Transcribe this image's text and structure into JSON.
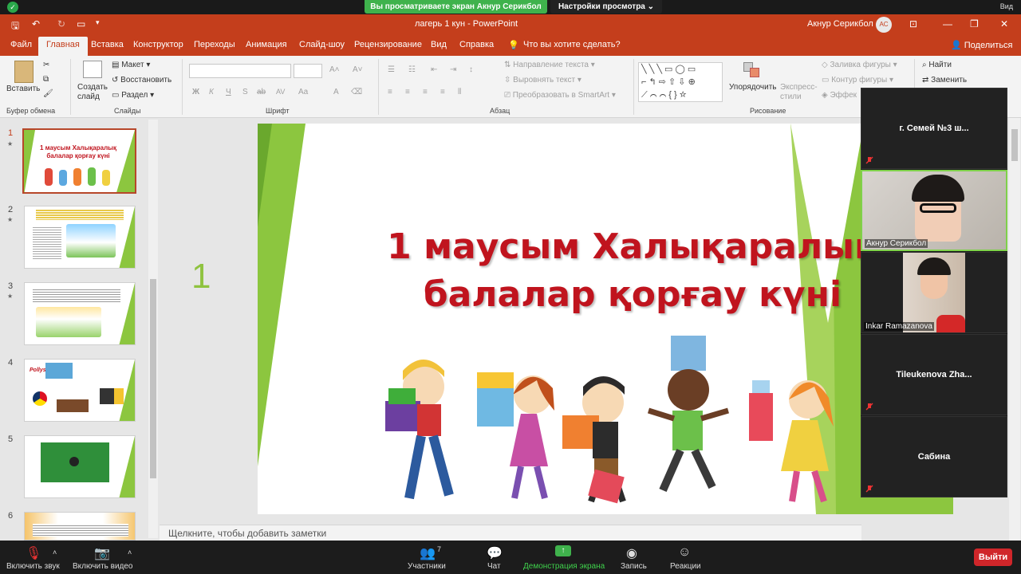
{
  "zoom": {
    "share_banner": "Вы просматриваете экран Акнур Серикбол",
    "view_settings": "Настройки просмотра ⌄",
    "view_label": "Вид",
    "toolbar": {
      "mute": "Включить звук",
      "video": "Включить видео",
      "participants": "Участники",
      "participants_count": "7",
      "chat": "Чат",
      "share": "Демонстрация экрана",
      "record": "Запись",
      "reactions": "Реакции",
      "leave": "Выйти"
    },
    "participants": [
      {
        "name": "г. Семей №3 ш...",
        "video": false
      },
      {
        "name": "Акнур Серикбол",
        "video": true
      },
      {
        "name": "Inkar Ramazanova",
        "video": true
      },
      {
        "name": "Tileukenova  Zha...",
        "video": false
      },
      {
        "name": "Сабина",
        "video": false
      }
    ]
  },
  "ppt": {
    "window_title": "лагерь 1 кун  -  PowerPoint",
    "user_name": "Акнур Серикбол",
    "user_initials": "АС",
    "tabs": [
      "Файл",
      "Главная",
      "Вставка",
      "Конструктор",
      "Переходы",
      "Анимация",
      "Слайд-шоу",
      "Рецензирование",
      "Вид",
      "Справка"
    ],
    "tell_me": "Что вы хотите сделать?",
    "share": "Поделиться",
    "ribbon": {
      "paste": "Вставить",
      "new_slide": "Создать слайд",
      "layout": "Макет",
      "reset": "Восстановить",
      "section": "Раздел",
      "text_direction": "Направление текста",
      "align_text": "Выровнять текст",
      "smartart": "Преобразовать в SmartArt",
      "arrange": "Упорядочить",
      "quick_styles": "Экспресс-стили",
      "shape_fill": "Заливка фигуры",
      "shape_outline": "Контур фигуры",
      "shape_effects": "Эффек",
      "find": "Найти",
      "replace": "Заменить",
      "groups": {
        "clipboard": "Буфер обмена",
        "slides": "Слайды",
        "font": "Шрифт",
        "paragraph": "Абзац",
        "drawing": "Рисование"
      },
      "font_buttons": [
        "Ж",
        "К",
        "Ч",
        "S",
        "ab",
        "AV",
        "Aa",
        "A"
      ]
    },
    "thumbnails": [
      {
        "num": "1",
        "star": "★",
        "title": "1 маусым Халықаралық балалар қорғау күні"
      },
      {
        "num": "2",
        "star": "★"
      },
      {
        "num": "3",
        "star": "★"
      },
      {
        "num": "4",
        "label": "Pollys"
      },
      {
        "num": "5"
      },
      {
        "num": "6"
      }
    ],
    "slide": {
      "title_line1": "1 маусым Халықаралық",
      "title_line2": "балалар қорғау күні"
    },
    "slide_number": "1",
    "notes_placeholder": "Щелкните, чтобы добавить заметки"
  }
}
